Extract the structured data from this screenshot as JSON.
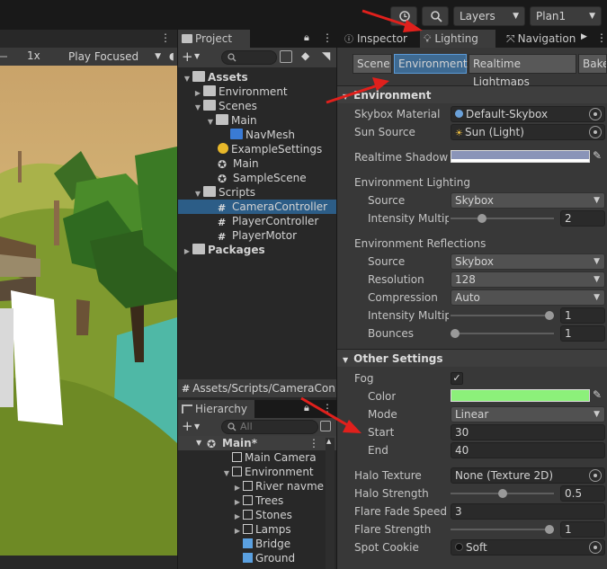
{
  "topbar": {
    "layers_label": "Layers",
    "layout_label": "Plan1"
  },
  "scene": {
    "zoom": "1x",
    "play_mode": "Play Focused"
  },
  "project": {
    "tab": "Project",
    "path": "Assets/Scripts/CameraCon",
    "tree": [
      {
        "label": "Assets",
        "bold": true
      },
      {
        "label": "Environment"
      },
      {
        "label": "Scenes"
      },
      {
        "label": "Main"
      },
      {
        "label": "NavMesh"
      },
      {
        "label": "ExampleSettings"
      },
      {
        "label": "Main"
      },
      {
        "label": "SampleScene"
      },
      {
        "label": "Scripts"
      },
      {
        "label": "CameraController"
      },
      {
        "label": "PlayerController"
      },
      {
        "label": "PlayerMotor"
      },
      {
        "label": "Packages",
        "bold": true
      }
    ]
  },
  "hierarchy": {
    "tab": "Hierarchy",
    "search_placeholder": "All",
    "rows": [
      {
        "label": "Main*"
      },
      {
        "label": "Main Camera"
      },
      {
        "label": "Environment"
      },
      {
        "label": "River navme"
      },
      {
        "label": "Trees"
      },
      {
        "label": "Stones"
      },
      {
        "label": "Lamps"
      },
      {
        "label": "Bridge"
      },
      {
        "label": "Ground"
      }
    ]
  },
  "inspector": {
    "tabs": [
      "Inspector",
      "Lighting",
      "Navigation"
    ],
    "subtabs": [
      "Scene",
      "Environment",
      "Realtime Lightmaps",
      "Bake"
    ],
    "environment": {
      "header": "Environment",
      "skybox_material_label": "Skybox Material",
      "skybox_material": "Default-Skybox",
      "sun_source_label": "Sun Source",
      "sun_source": "Sun (Light)",
      "realtime_shadow_label": "Realtime Shadow C",
      "realtime_shadow_color": "#8a94b8",
      "lighting_header": "Environment Lighting",
      "source_label": "Source",
      "source": "Skybox",
      "intensity_label": "Intensity Multipl",
      "intensity": "2",
      "intensity_fraction": 0.29,
      "reflections_header": "Environment Reflections",
      "refl_source_label": "Source",
      "refl_source": "Skybox",
      "resolution_label": "Resolution",
      "resolution": "128",
      "compression_label": "Compression",
      "compression": "Auto",
      "refl_intensity_label": "Intensity Multipl",
      "refl_intensity": "1",
      "refl_intensity_fraction": 1.0,
      "bounces_label": "Bounces",
      "bounces": "1",
      "bounces_fraction": 0.0
    },
    "other": {
      "header": "Other Settings",
      "fog_label": "Fog",
      "fog_checked": "✓",
      "color_label": "Color",
      "fog_color": "#8cf07a",
      "mode_label": "Mode",
      "mode": "Linear",
      "start_label": "Start",
      "start": "30",
      "end_label": "End",
      "end": "40",
      "halo_texture_label": "Halo Texture",
      "halo_texture": "None (Texture 2D)",
      "halo_strength_label": "Halo Strength",
      "halo_strength": "0.5",
      "halo_strength_fraction": 0.5,
      "flare_fade_label": "Flare Fade Speed",
      "flare_fade": "3",
      "flare_strength_label": "Flare Strength",
      "flare_strength": "1",
      "flare_strength_fraction": 1.0,
      "spot_cookie_label": "Spot Cookie",
      "spot_cookie": "Soft"
    }
  },
  "colors": {
    "accent": "#2c5d87",
    "annotation_arrow": "#e0201c"
  }
}
